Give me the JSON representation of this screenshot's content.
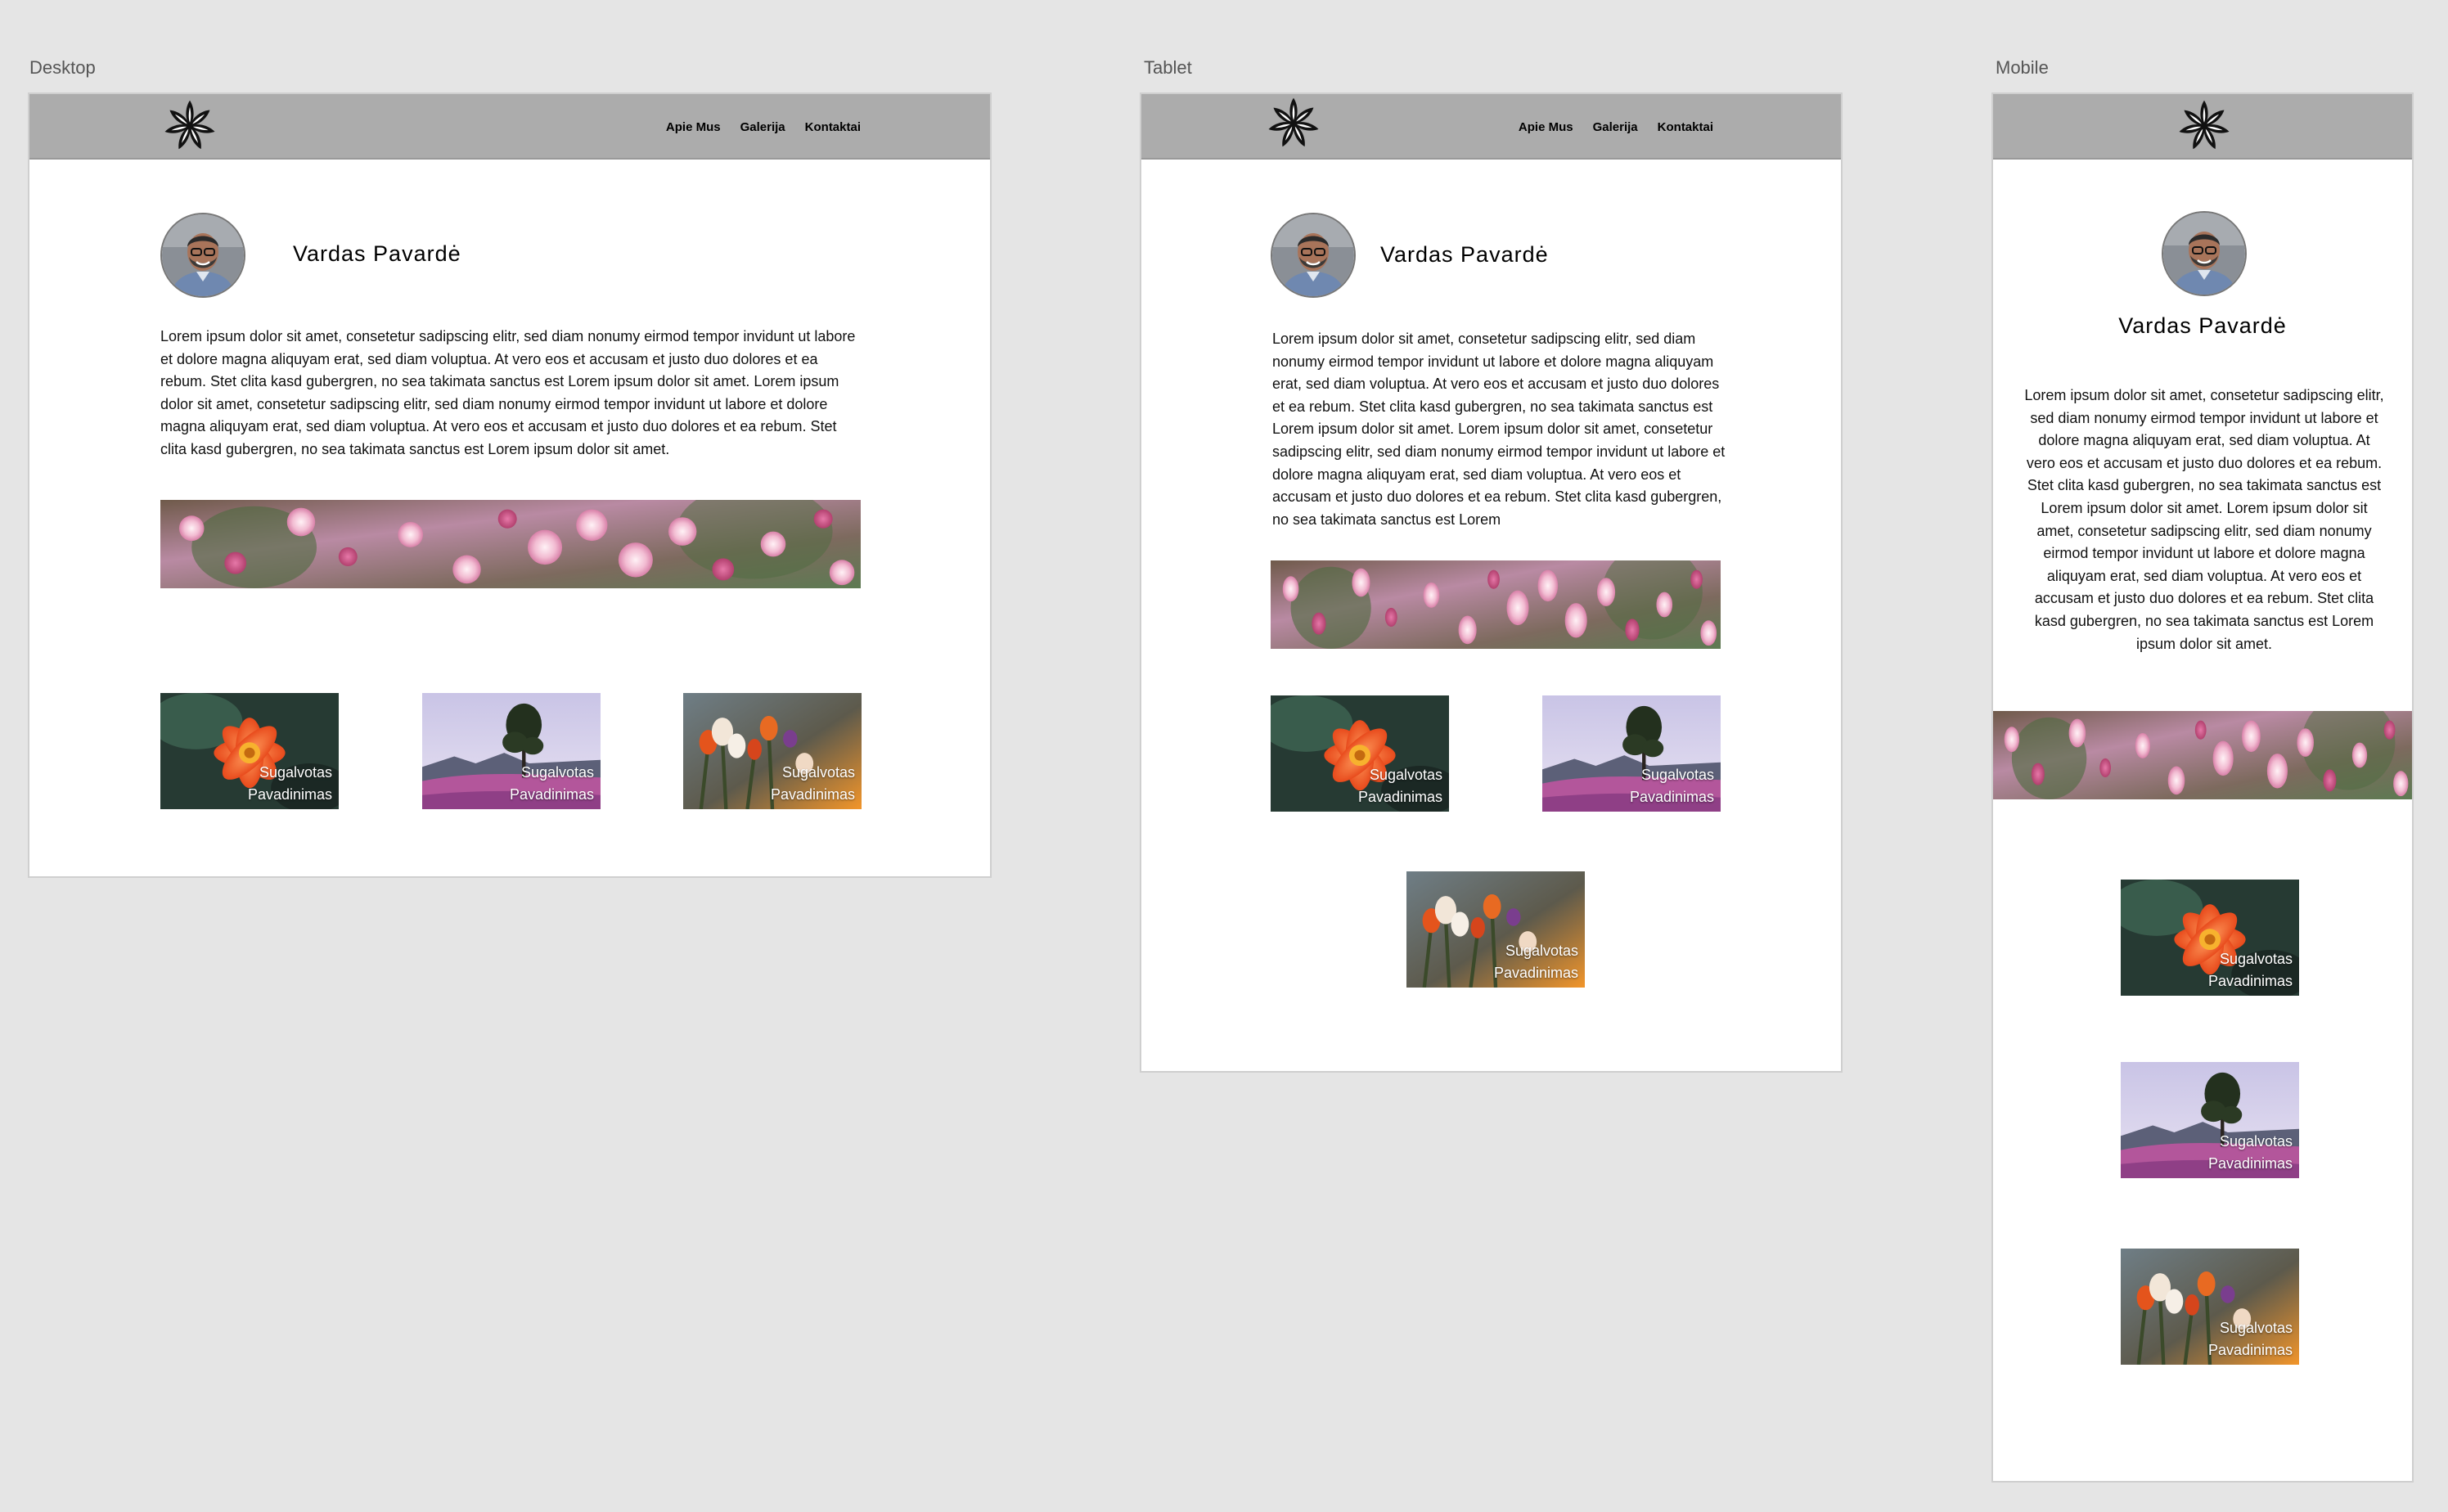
{
  "frames": {
    "desktop_label": "Desktop",
    "tablet_label": "Tablet",
    "mobile_label": "Mobile"
  },
  "nav": {
    "items": [
      "Apie Mus",
      "Galerija",
      "Kontaktai"
    ]
  },
  "profile": {
    "name": "Vardas Pavardė"
  },
  "text": {
    "desktop": "Lorem ipsum dolor sit amet, consetetur sadipscing elitr, sed diam nonumy eirmod tempor invidunt ut labore et dolore magna aliquyam erat, sed diam voluptua. At vero eos et accusam et justo duo dolores et ea rebum. Stet clita kasd gubergren, no sea takimata sanctus est Lorem ipsum dolor sit amet. Lorem ipsum dolor sit amet, consetetur sadipscing elitr, sed diam nonumy eirmod tempor invidunt ut labore et dolore magna aliquyam erat, sed diam voluptua. At vero eos et accusam et justo duo dolores et ea rebum. Stet clita kasd gubergren, no sea takimata sanctus est Lorem ipsum dolor sit amet.",
    "tablet": "Lorem ipsum dolor sit amet, consetetur sadipscing elitr, sed diam nonumy eirmod tempor invidunt ut labore et dolore magna aliquyam erat, sed diam voluptua. At vero eos et accusam et justo duo dolores et ea rebum. Stet clita kasd gubergren, no sea takimata sanctus est Lorem ipsum dolor sit amet. Lorem ipsum dolor sit amet, consetetur sadipscing elitr, sed diam nonumy eirmod tempor invidunt ut labore et dolore magna aliquyam erat, sed diam voluptua. At vero eos et accusam et justo duo dolores et ea rebum. Stet clita kasd gubergren, no sea takimata sanctus est Lorem",
    "mobile": "Lorem ipsum dolor sit amet, consetetur sadipscing elitr, sed diam nonumy eirmod tempor invidunt ut labore et dolore magna aliquyam erat, sed diam voluptua. At vero eos et accusam et justo duo dolores et ea rebum. Stet clita kasd gubergren, no sea takimata sanctus est Lorem ipsum dolor sit amet. Lorem ipsum dolor sit amet, consetetur sadipscing elitr, sed diam nonumy eirmod tempor invidunt ut labore et dolore magna aliquyam erat, sed diam voluptua. At vero eos et accusam et justo duo dolores et ea rebum. Stet clita kasd gubergren, no sea takimata sanctus est Lorem ipsum dolor sit amet."
  },
  "gallery": [
    {
      "caption_line1": "Sugalvotas",
      "caption_line2": "Pavadinimas",
      "image": "orange-flower"
    },
    {
      "caption_line1": "Sugalvotas",
      "caption_line2": "Pavadinimas",
      "image": "tree-meadow"
    },
    {
      "caption_line1": "Sugalvotas",
      "caption_line2": "Pavadinimas",
      "image": "wildflowers"
    }
  ],
  "images": {
    "logo": "flower-logo-icon",
    "avatar": "smiling-man-portrait",
    "banner": "pink-blossoms"
  },
  "colors": {
    "canvas": "#e5e5e5",
    "navbar": "#acacac",
    "artboard": "#ffffff"
  }
}
